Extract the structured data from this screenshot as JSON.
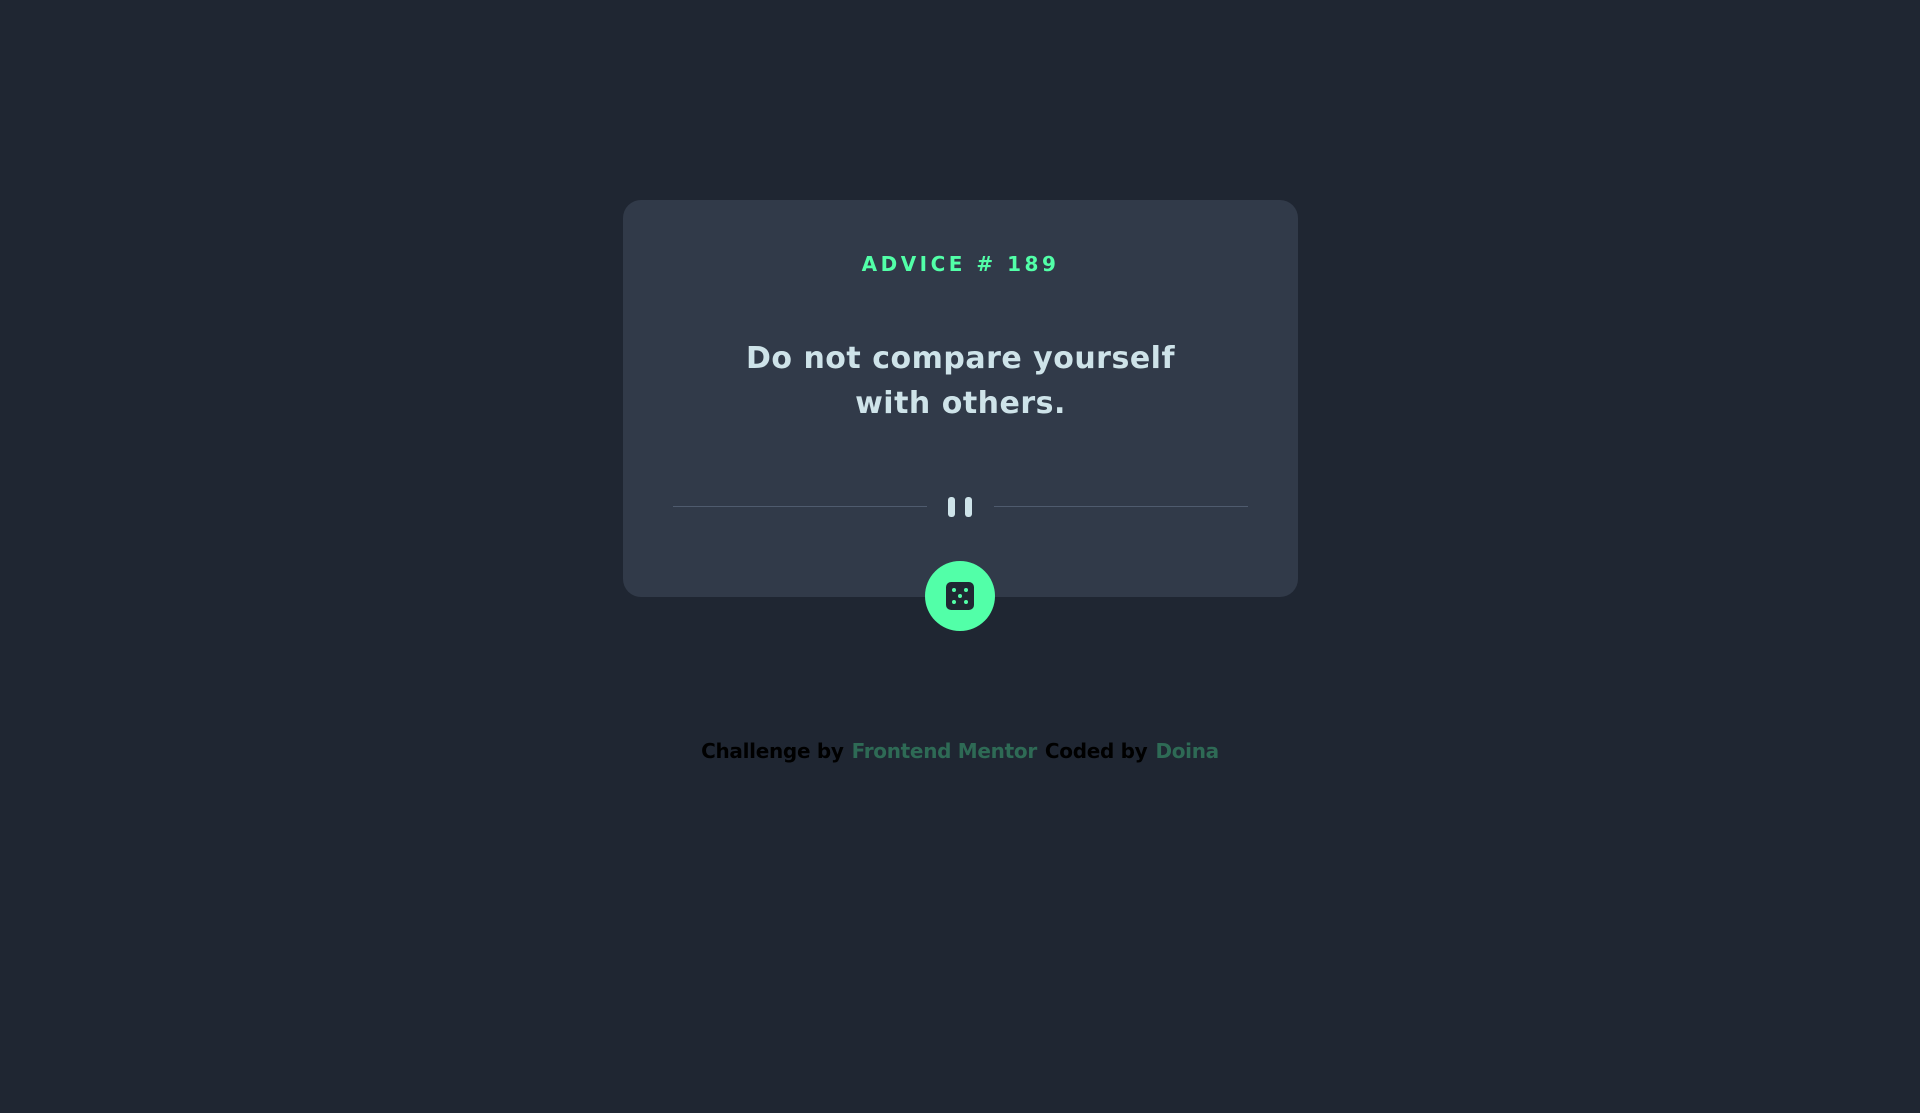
{
  "card": {
    "advice_id": "ADVICE # 189",
    "advice_text": "Do not compare yourself with others."
  },
  "icons": {
    "divider": "pause-icon",
    "dice": "dice-icon"
  },
  "attribution": {
    "challenge_prefix": "Challenge by",
    "challenge_link": "Frontend Mentor",
    "coded_prefix": "Coded by",
    "coded_link": "Doina"
  },
  "colors": {
    "background": "#1f2632",
    "card": "#313a49",
    "accent": "#52ffa8",
    "text": "#cee3e9",
    "link": "#2e6a55"
  }
}
